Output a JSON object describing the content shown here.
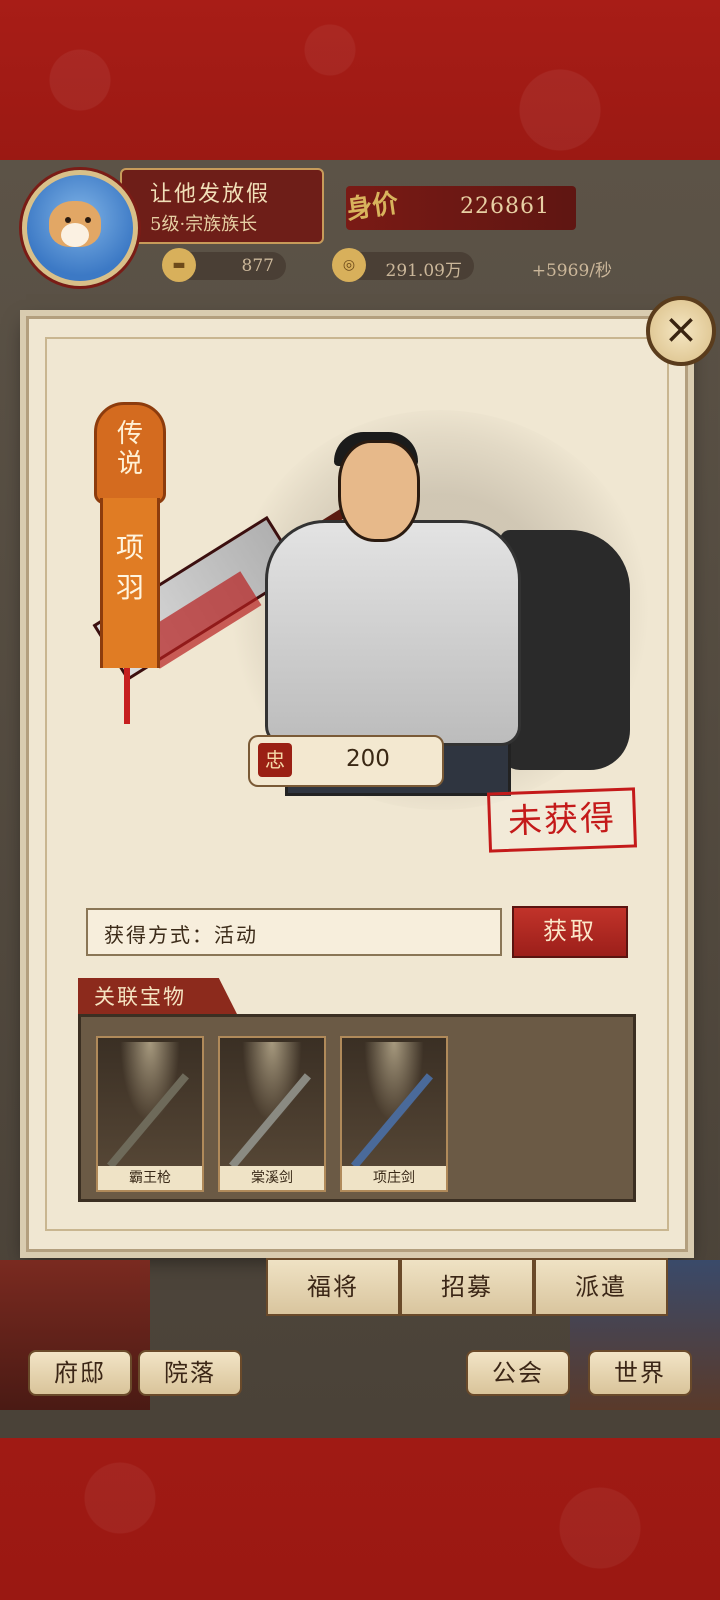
{
  "player": {
    "name": "让他发放假",
    "level_title": "5级·宗族族长",
    "worth_label": "身价",
    "worth_value": "226861"
  },
  "resources": [
    {
      "icon": "ingot-icon",
      "value": "877"
    },
    {
      "icon": "coin-icon",
      "value": "291.09万"
    },
    {
      "icon": "none",
      "value": "+5969/秒"
    }
  ],
  "hero": {
    "rarity": "传说",
    "name": "项羽",
    "loyalty_icon": "忠",
    "loyalty_value": "200",
    "status_stamp": "未获得"
  },
  "obtain": {
    "label": "获得方式：活动",
    "button": "获取"
  },
  "related": {
    "title": "关联宝物",
    "items": [
      {
        "name": "霸王枪",
        "weapon_color": "#6e6a5a"
      },
      {
        "name": "棠溪剑",
        "weapon_color": "#8a8a82"
      },
      {
        "name": "项庄剑",
        "weapon_color": "#4a6a9a"
      }
    ]
  },
  "tabs": [
    "福将",
    "招募",
    "派遣"
  ],
  "nav": [
    "府邸",
    "院落",
    "公会",
    "世界"
  ],
  "colors": {
    "accent_red": "#9c1f1a",
    "parchment": "#f0e7d2",
    "rarity_orange": "#e07c24"
  }
}
